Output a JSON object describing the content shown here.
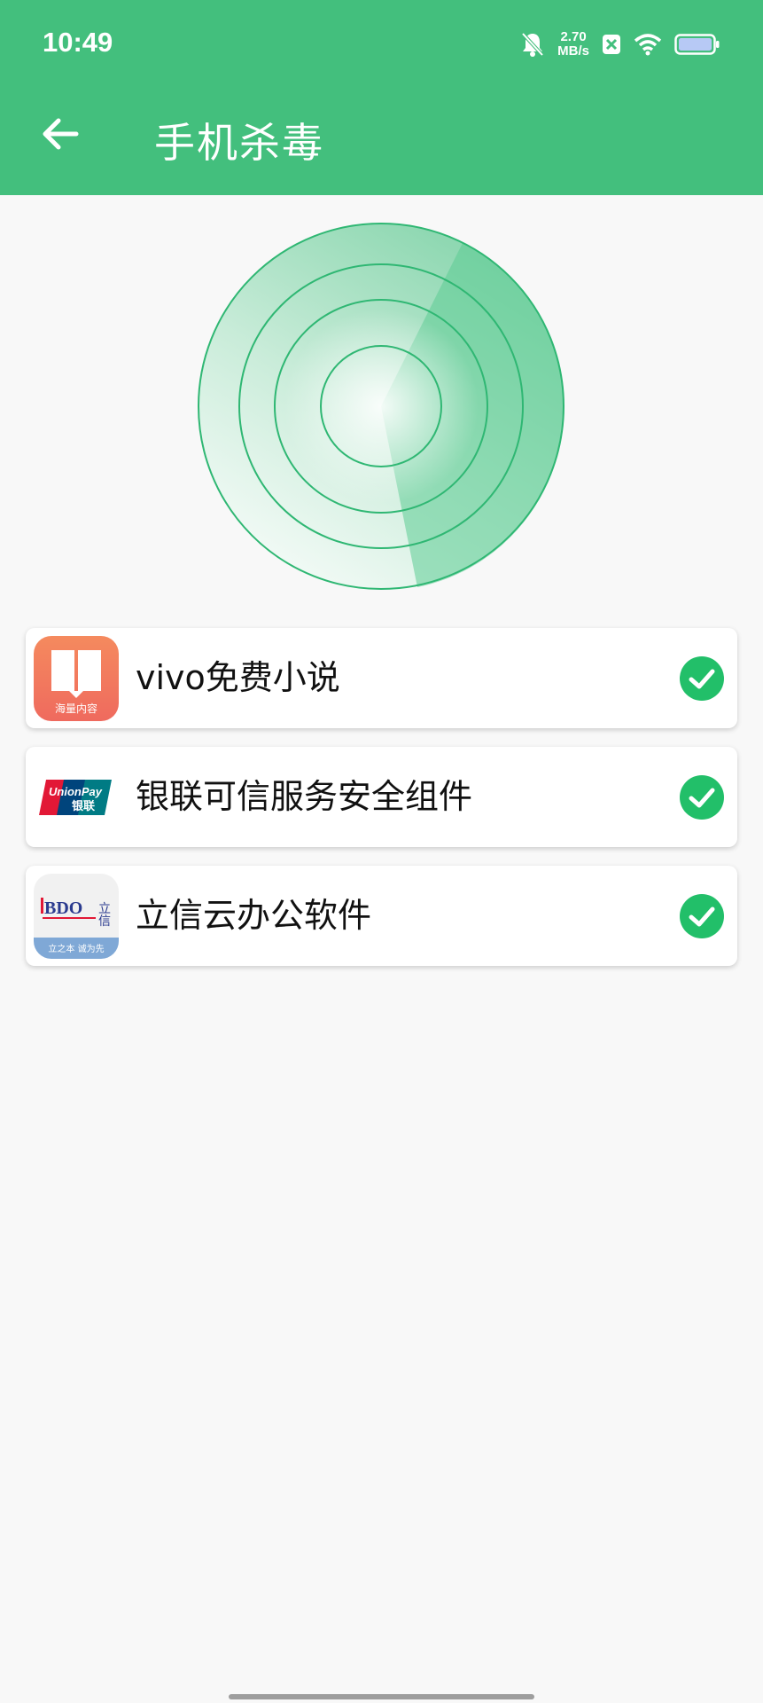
{
  "status_bar": {
    "time": "10:49",
    "net_speed_value": "2.70",
    "net_speed_unit": "MB/s",
    "icons": [
      "bell-muted-icon",
      "close-notification-icon",
      "wifi-icon",
      "battery-icon"
    ]
  },
  "header": {
    "title": "手机杀毒",
    "back_icon": "arrow-left-icon",
    "background_color": "#43bf7d"
  },
  "scan": {
    "accent_color": "#2ec27e"
  },
  "apps": [
    {
      "name": "vivo免费小说",
      "icon": "vivo-novel-app-icon",
      "icon_text": "海量内容",
      "status": "safe"
    },
    {
      "name": "银联可信服务安全组件",
      "icon": "unionpay-app-icon",
      "icon_text": "UnionPay 银联",
      "status": "safe"
    },
    {
      "name": "立信云办公软件",
      "icon": "bdo-app-icon",
      "icon_text": "BDO 立信",
      "icon_subtext": "立之本  诚为先",
      "status": "safe"
    }
  ]
}
